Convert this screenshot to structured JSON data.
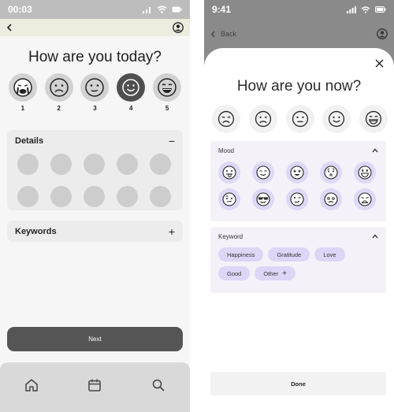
{
  "left": {
    "status_time": "00:03",
    "title": "How are you today?",
    "moods": [
      {
        "num": "1",
        "icon": "crying-face-icon"
      },
      {
        "num": "2",
        "icon": "frown-face-icon"
      },
      {
        "num": "3",
        "icon": "neutral-face-icon"
      },
      {
        "num": "4",
        "icon": "smile-face-icon",
        "selected": true
      },
      {
        "num": "5",
        "icon": "grin-face-icon"
      }
    ],
    "details": {
      "title": "Details",
      "toggle": "−"
    },
    "keywords": {
      "title": "Keywords",
      "toggle": "+"
    },
    "next_label": "Next",
    "tabs": [
      "home-icon",
      "calendar-icon",
      "search-icon"
    ]
  },
  "right": {
    "status_time": "9:41",
    "back_label": "Back",
    "title": "How are you now?",
    "faces": [
      "sad-face-icon",
      "frown-face-icon",
      "neutral-face-icon",
      "smile-face-icon",
      "grin-face-icon"
    ],
    "mood_panel": {
      "title": "Mood",
      "toggle": "^"
    },
    "keyword_panel": {
      "title": "Keyword",
      "toggle": "^"
    },
    "keywords": [
      "Happiness",
      "Gratitude",
      "Love",
      "Good"
    ],
    "other_label": "Other",
    "other_icon": "+",
    "done_label": "Done"
  },
  "colors": {
    "accent_purple": "#ddd6f6",
    "dark_gray": "#4f4f4f"
  }
}
